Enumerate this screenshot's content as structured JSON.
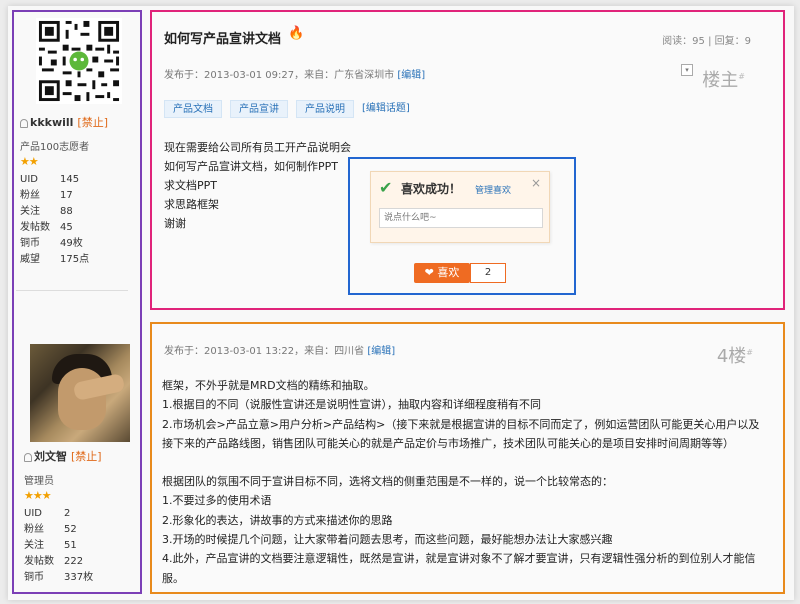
{
  "users": [
    {
      "name": "kkkwill",
      "ban": "[禁止]",
      "title": "产品100志愿者",
      "stars": "★★",
      "stats": [
        {
          "k": "UID",
          "v": "145"
        },
        {
          "k": "粉丝",
          "v": "17"
        },
        {
          "k": "关注",
          "v": "88"
        },
        {
          "k": "发帖数",
          "v": "45"
        },
        {
          "k": "铜币",
          "v": "49枚"
        },
        {
          "k": "威望",
          "v": "175点"
        }
      ]
    },
    {
      "name": "刘文智",
      "ban": "[禁止]",
      "title": "管理员",
      "stars": "★★★",
      "stats": [
        {
          "k": "UID",
          "v": "2"
        },
        {
          "k": "粉丝",
          "v": "52"
        },
        {
          "k": "关注",
          "v": "51"
        },
        {
          "k": "发帖数",
          "v": "222"
        },
        {
          "k": "铜币",
          "v": "337枚"
        }
      ]
    }
  ],
  "post1": {
    "title": "如何写产品宣讲文档",
    "views": "阅读：95",
    "replies": "回复：9",
    "meta_prefix": "发布于：2013-03-01 09:27，来自：广东省深圳市",
    "edit": "[编辑]",
    "floor": "楼主",
    "floor_mark": "#",
    "tags": [
      "产品文档",
      "产品宣讲",
      "产品说明"
    ],
    "edit_tags": "[编辑话题]",
    "body": [
      "现在需要给公司所有员工开产品说明会",
      "如何写产品宣讲文档，如何制作PPT",
      "求文档PPT",
      "求思路框架",
      "谢谢"
    ]
  },
  "popup": {
    "title": "喜欢成功！",
    "manage": "管理喜欢",
    "close": "×",
    "placeholder": "说点什么吧~",
    "like_label": "喜欢",
    "like_count": "2"
  },
  "post2": {
    "meta_prefix": "发布于：2013-03-01 13:22，来自：四川省",
    "edit": "[编辑]",
    "floor": "4楼",
    "floor_mark": "#",
    "para1": [
      "框架，不外乎就是MRD文档的精练和抽取。",
      "1.根据目的不同（说服性宣讲还是说明性宣讲），抽取内容和详细程度稍有不同",
      "2.市场机会>产品立意>用户分析>产品结构>（接下来就是根据宣讲的目标不同而定了，例如运营团队可能更关心用户以及",
      "接下来的产品路线图，销售团队可能关心的就是产品定价与市场推广，技术团队可能关心的是项目安排时间周期等等）"
    ],
    "para2": [
      "根据团队的氛围不同于宣讲目标不同，选将文档的侧重范围是不一样的，说一个比较常态的：",
      "1.不要过多的使用术语",
      "2.形象化的表达，讲故事的方式来描述你的思路",
      "3.开场的时候提几个问题，让大家带着问题去思考，而这些问题，最好能想办法让大家感兴趣",
      "4.此外，产品宣讲的文档要注意逻辑性，既然是宣讲，就是宣讲对象不了解才要宣讲，只有逻辑性强分析的到位别人才能信",
      "服。"
    ]
  }
}
